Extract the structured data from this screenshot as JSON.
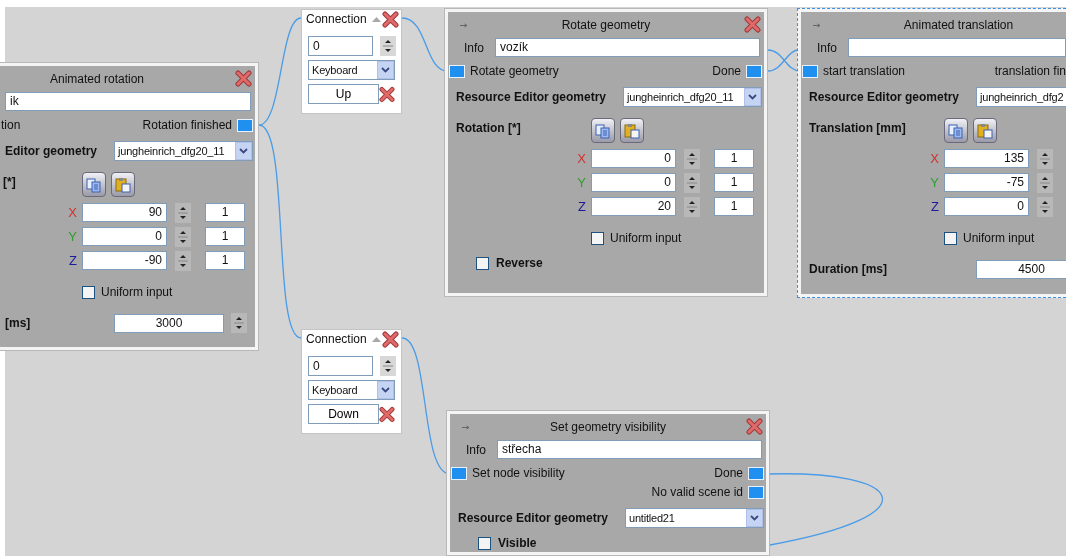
{
  "canvas": {
    "nodes": [
      {
        "kind": "block",
        "title": "Animated rotation",
        "selected": false,
        "info": "ik",
        "inputs": [
          {
            "label": "tion"
          }
        ],
        "outputs": [
          {
            "label": "Rotation finished"
          }
        ],
        "geometry": {
          "label": "Editor geometry",
          "value": "jungheinrich_dfg20_11"
        },
        "vector": {
          "label": "[*]",
          "axes": [
            {
              "axis": "X",
              "color": "#d03030",
              "value": "90",
              "step": "1"
            },
            {
              "axis": "Y",
              "color": "#2e9e2e",
              "value": "0",
              "step": "1"
            },
            {
              "axis": "Z",
              "color": "#1c1c9a",
              "value": "-90",
              "step": "1"
            }
          ]
        },
        "uniform": {
          "label": "Uniform input",
          "checked": false
        },
        "duration": {
          "label": "[ms]",
          "value": "3000"
        }
      },
      {
        "kind": "connection",
        "title": "Connection",
        "value": "0",
        "device": "Keyboard",
        "key": "Up"
      },
      {
        "kind": "block",
        "title": "Rotate geometry",
        "selected": false,
        "info_label": "Info",
        "info": "vozík",
        "inputs": [
          {
            "label": "Rotate geometry"
          }
        ],
        "outputs": [
          {
            "label": "Done"
          }
        ],
        "geometry": {
          "label": "Resource Editor geometry",
          "value": "jungheinrich_dfg20_11"
        },
        "vector": {
          "label": "Rotation [*]",
          "axes": [
            {
              "axis": "X",
              "color": "#d03030",
              "value": "0",
              "step": "1"
            },
            {
              "axis": "Y",
              "color": "#2e9e2e",
              "value": "0",
              "step": "1"
            },
            {
              "axis": "Z",
              "color": "#1c1c9a",
              "value": "20",
              "step": "1"
            }
          ]
        },
        "uniform": {
          "label": "Uniform input",
          "checked": false
        },
        "option": {
          "label": "Reverse",
          "checked": false
        }
      },
      {
        "kind": "block",
        "title": "Animated translation",
        "selected": true,
        "info_label": "Info",
        "inputs": [
          {
            "label": "start translation"
          }
        ],
        "outputs": [
          {
            "label": "translation fin"
          }
        ],
        "geometry": {
          "label": "Resource Editor geometry",
          "value": "jungheinrich_dfg2"
        },
        "vector": {
          "label": "Translation [mm]",
          "axes": [
            {
              "axis": "X",
              "color": "#d03030",
              "value": "135"
            },
            {
              "axis": "Y",
              "color": "#2e9e2e",
              "value": "-75"
            },
            {
              "axis": "Z",
              "color": "#1c1c9a",
              "value": "0"
            }
          ]
        },
        "uniform": {
          "label": "Uniform input",
          "checked": false
        },
        "duration": {
          "label": "Duration [ms]",
          "value": "4500"
        }
      },
      {
        "kind": "connection",
        "title": "Connection",
        "value": "0",
        "device": "Keyboard",
        "key": "Down"
      },
      {
        "kind": "block",
        "title": "Set geometry visibility",
        "selected": false,
        "info_label": "Info",
        "info": "střecha",
        "inputs": [
          {
            "label": "Set node visibility"
          }
        ],
        "outputs": [
          {
            "label": "Done"
          },
          {
            "label": "No valid scene id"
          }
        ],
        "geometry": {
          "label": "Resource Editor geometry",
          "value": "untitled21"
        },
        "option": {
          "label": "Visible",
          "checked": false
        }
      }
    ]
  }
}
